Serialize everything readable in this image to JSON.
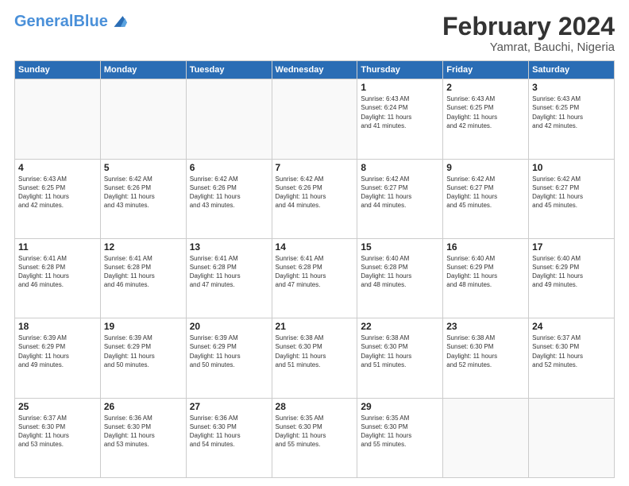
{
  "header": {
    "logo_general": "General",
    "logo_blue": "Blue",
    "title": "February 2024",
    "subtitle": "Yamrat, Bauchi, Nigeria"
  },
  "days_of_week": [
    "Sunday",
    "Monday",
    "Tuesday",
    "Wednesday",
    "Thursday",
    "Friday",
    "Saturday"
  ],
  "weeks": [
    [
      {
        "day": "",
        "info": ""
      },
      {
        "day": "",
        "info": ""
      },
      {
        "day": "",
        "info": ""
      },
      {
        "day": "",
        "info": ""
      },
      {
        "day": "1",
        "info": "Sunrise: 6:43 AM\nSunset: 6:24 PM\nDaylight: 11 hours\nand 41 minutes."
      },
      {
        "day": "2",
        "info": "Sunrise: 6:43 AM\nSunset: 6:25 PM\nDaylight: 11 hours\nand 42 minutes."
      },
      {
        "day": "3",
        "info": "Sunrise: 6:43 AM\nSunset: 6:25 PM\nDaylight: 11 hours\nand 42 minutes."
      }
    ],
    [
      {
        "day": "4",
        "info": "Sunrise: 6:43 AM\nSunset: 6:25 PM\nDaylight: 11 hours\nand 42 minutes."
      },
      {
        "day": "5",
        "info": "Sunrise: 6:42 AM\nSunset: 6:26 PM\nDaylight: 11 hours\nand 43 minutes."
      },
      {
        "day": "6",
        "info": "Sunrise: 6:42 AM\nSunset: 6:26 PM\nDaylight: 11 hours\nand 43 minutes."
      },
      {
        "day": "7",
        "info": "Sunrise: 6:42 AM\nSunset: 6:26 PM\nDaylight: 11 hours\nand 44 minutes."
      },
      {
        "day": "8",
        "info": "Sunrise: 6:42 AM\nSunset: 6:27 PM\nDaylight: 11 hours\nand 44 minutes."
      },
      {
        "day": "9",
        "info": "Sunrise: 6:42 AM\nSunset: 6:27 PM\nDaylight: 11 hours\nand 45 minutes."
      },
      {
        "day": "10",
        "info": "Sunrise: 6:42 AM\nSunset: 6:27 PM\nDaylight: 11 hours\nand 45 minutes."
      }
    ],
    [
      {
        "day": "11",
        "info": "Sunrise: 6:41 AM\nSunset: 6:28 PM\nDaylight: 11 hours\nand 46 minutes."
      },
      {
        "day": "12",
        "info": "Sunrise: 6:41 AM\nSunset: 6:28 PM\nDaylight: 11 hours\nand 46 minutes."
      },
      {
        "day": "13",
        "info": "Sunrise: 6:41 AM\nSunset: 6:28 PM\nDaylight: 11 hours\nand 47 minutes."
      },
      {
        "day": "14",
        "info": "Sunrise: 6:41 AM\nSunset: 6:28 PM\nDaylight: 11 hours\nand 47 minutes."
      },
      {
        "day": "15",
        "info": "Sunrise: 6:40 AM\nSunset: 6:28 PM\nDaylight: 11 hours\nand 48 minutes."
      },
      {
        "day": "16",
        "info": "Sunrise: 6:40 AM\nSunset: 6:29 PM\nDaylight: 11 hours\nand 48 minutes."
      },
      {
        "day": "17",
        "info": "Sunrise: 6:40 AM\nSunset: 6:29 PM\nDaylight: 11 hours\nand 49 minutes."
      }
    ],
    [
      {
        "day": "18",
        "info": "Sunrise: 6:39 AM\nSunset: 6:29 PM\nDaylight: 11 hours\nand 49 minutes."
      },
      {
        "day": "19",
        "info": "Sunrise: 6:39 AM\nSunset: 6:29 PM\nDaylight: 11 hours\nand 50 minutes."
      },
      {
        "day": "20",
        "info": "Sunrise: 6:39 AM\nSunset: 6:29 PM\nDaylight: 11 hours\nand 50 minutes."
      },
      {
        "day": "21",
        "info": "Sunrise: 6:38 AM\nSunset: 6:30 PM\nDaylight: 11 hours\nand 51 minutes."
      },
      {
        "day": "22",
        "info": "Sunrise: 6:38 AM\nSunset: 6:30 PM\nDaylight: 11 hours\nand 51 minutes."
      },
      {
        "day": "23",
        "info": "Sunrise: 6:38 AM\nSunset: 6:30 PM\nDaylight: 11 hours\nand 52 minutes."
      },
      {
        "day": "24",
        "info": "Sunrise: 6:37 AM\nSunset: 6:30 PM\nDaylight: 11 hours\nand 52 minutes."
      }
    ],
    [
      {
        "day": "25",
        "info": "Sunrise: 6:37 AM\nSunset: 6:30 PM\nDaylight: 11 hours\nand 53 minutes."
      },
      {
        "day": "26",
        "info": "Sunrise: 6:36 AM\nSunset: 6:30 PM\nDaylight: 11 hours\nand 53 minutes."
      },
      {
        "day": "27",
        "info": "Sunrise: 6:36 AM\nSunset: 6:30 PM\nDaylight: 11 hours\nand 54 minutes."
      },
      {
        "day": "28",
        "info": "Sunrise: 6:35 AM\nSunset: 6:30 PM\nDaylight: 11 hours\nand 55 minutes."
      },
      {
        "day": "29",
        "info": "Sunrise: 6:35 AM\nSunset: 6:30 PM\nDaylight: 11 hours\nand 55 minutes."
      },
      {
        "day": "",
        "info": ""
      },
      {
        "day": "",
        "info": ""
      }
    ]
  ]
}
